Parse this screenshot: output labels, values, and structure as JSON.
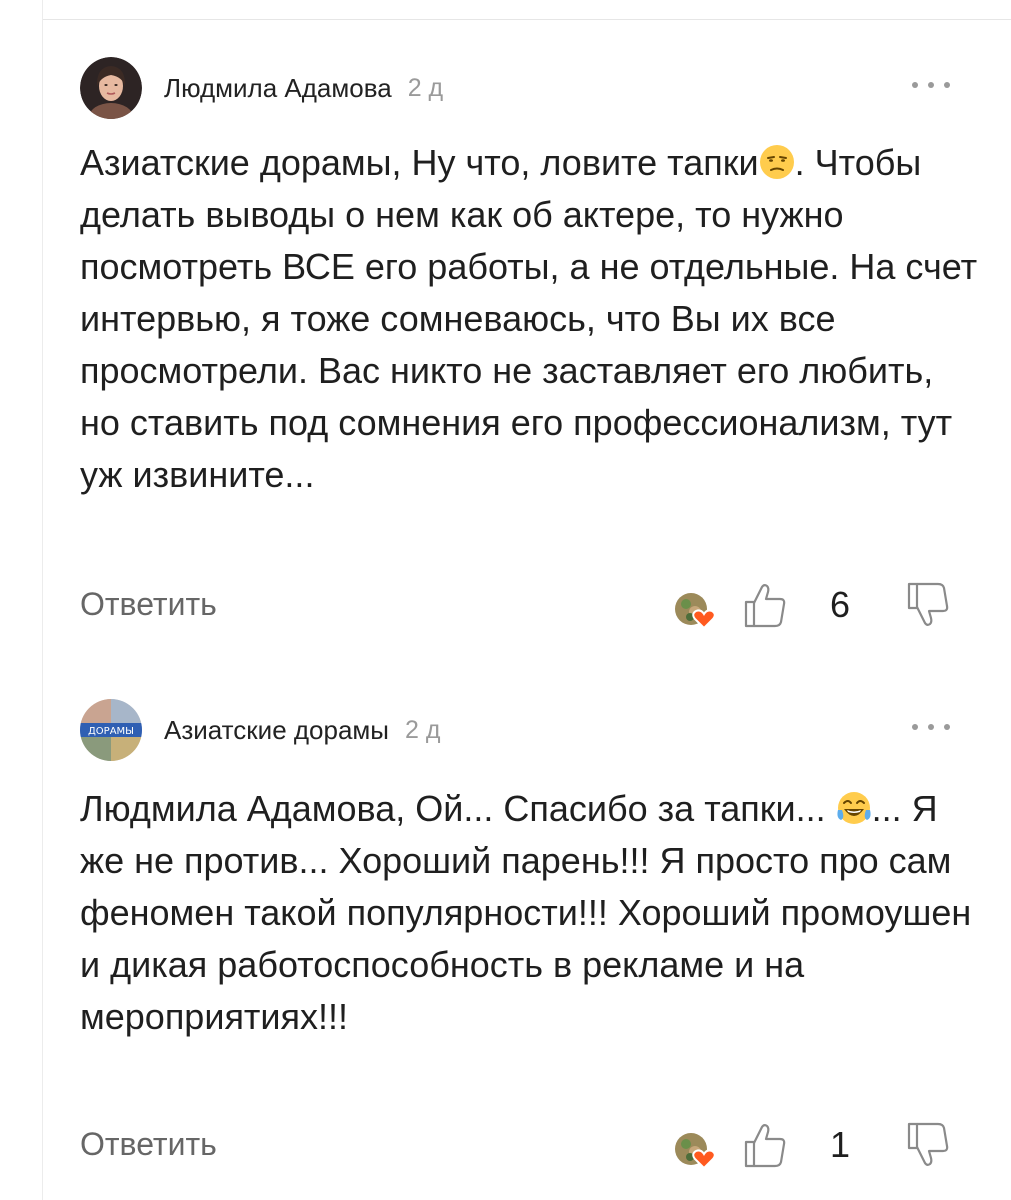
{
  "comments": [
    {
      "author": "Людмила Адамова",
      "time": "2 д",
      "avatar": "avatar-woman-photo",
      "text_parts": [
        "Азиатские дорамы, Ну что, ловите тапки",
        ". Чтобы делать выводы о нем как об актере, то нужно посмотреть ВСЕ его работы, а не отдельные. На счет интервью, я тоже сомневаюсь, что Вы их все просмотрели. Вас никто не заставляет его любить, но ставить под сомнения его профессионализм, тут уж извините..."
      ],
      "emoji": "unamused-face",
      "reply_label": "Ответить",
      "likes": "6"
    },
    {
      "author": "Азиатские дорамы",
      "time": "2 д",
      "avatar": "avatar-channel-logo",
      "avatar_label": "ДОРАМЫ",
      "text_parts": [
        "Людмила Адамова, Ой... Спасибо за тапки... ",
        "... Я же не против... Хороший парень!!! Я просто про сам феномен такой популярности!!! Хороший промоушен и дикая работоспособность в рекламе и на мероприятиях!!!"
      ],
      "emoji": "tears-of-joy-face",
      "reply_label": "Ответить",
      "likes": "1"
    }
  ],
  "colors": {
    "text": "#1f1f1f",
    "muted": "#9a9a9a",
    "reply": "#666666",
    "heart": "#ff5a1f",
    "divider": "#e6e6e6"
  }
}
